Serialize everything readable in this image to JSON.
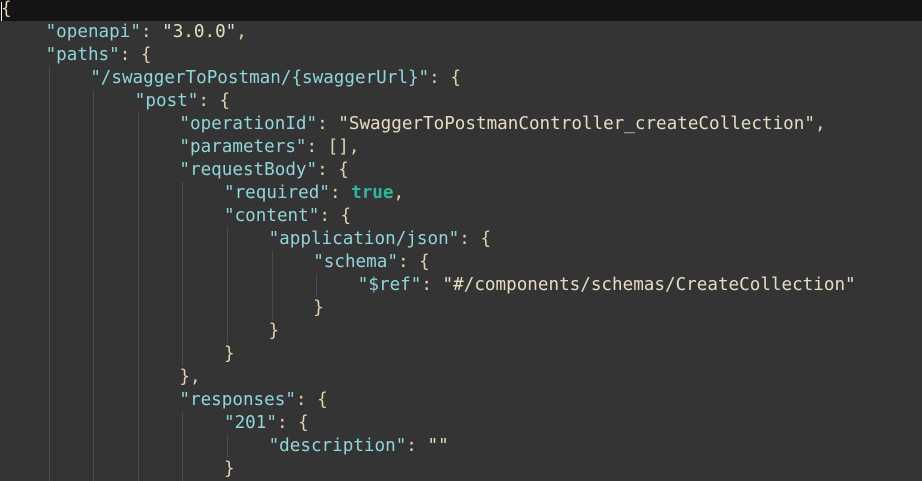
{
  "editor": {
    "lines": [
      {
        "indent": 0,
        "tokens": [
          {
            "t": "punct",
            "v": "{"
          }
        ]
      },
      {
        "indent": 1,
        "tokens": [
          {
            "t": "key",
            "v": "\"openapi\""
          },
          {
            "t": "punct",
            "v": ": "
          },
          {
            "t": "str",
            "v": "\"3.0.0\""
          },
          {
            "t": "punct",
            "v": ","
          }
        ]
      },
      {
        "indent": 1,
        "tokens": [
          {
            "t": "key",
            "v": "\"paths\""
          },
          {
            "t": "punct",
            "v": ": {"
          }
        ]
      },
      {
        "indent": 2,
        "tokens": [
          {
            "t": "key",
            "v": "\"/swaggerToPostman/{swaggerUrl}\""
          },
          {
            "t": "punct",
            "v": ": {"
          }
        ]
      },
      {
        "indent": 3,
        "tokens": [
          {
            "t": "key",
            "v": "\"post\""
          },
          {
            "t": "punct",
            "v": ": {"
          }
        ]
      },
      {
        "indent": 4,
        "tokens": [
          {
            "t": "key",
            "v": "\"operationId\""
          },
          {
            "t": "punct",
            "v": ": "
          },
          {
            "t": "str",
            "v": "\"SwaggerToPostmanController_createCollection\""
          },
          {
            "t": "punct",
            "v": ","
          }
        ]
      },
      {
        "indent": 4,
        "tokens": [
          {
            "t": "key",
            "v": "\"parameters\""
          },
          {
            "t": "punct",
            "v": ": [],"
          }
        ]
      },
      {
        "indent": 4,
        "tokens": [
          {
            "t": "key",
            "v": "\"requestBody\""
          },
          {
            "t": "punct",
            "v": ": {"
          }
        ]
      },
      {
        "indent": 5,
        "tokens": [
          {
            "t": "key",
            "v": "\"required\""
          },
          {
            "t": "punct",
            "v": ": "
          },
          {
            "t": "bool",
            "v": "true"
          },
          {
            "t": "punct",
            "v": ","
          }
        ]
      },
      {
        "indent": 5,
        "tokens": [
          {
            "t": "key",
            "v": "\"content\""
          },
          {
            "t": "punct",
            "v": ": {"
          }
        ]
      },
      {
        "indent": 6,
        "tokens": [
          {
            "t": "key",
            "v": "\"application/json\""
          },
          {
            "t": "punct",
            "v": ": {"
          }
        ]
      },
      {
        "indent": 7,
        "tokens": [
          {
            "t": "key",
            "v": "\"schema\""
          },
          {
            "t": "punct",
            "v": ": {"
          }
        ]
      },
      {
        "indent": 8,
        "tokens": [
          {
            "t": "key",
            "v": "\"$ref\""
          },
          {
            "t": "punct",
            "v": ": "
          },
          {
            "t": "str",
            "v": "\"#/components/schemas/CreateCollection\""
          }
        ]
      },
      {
        "indent": 7,
        "tokens": [
          {
            "t": "punct",
            "v": "}"
          }
        ]
      },
      {
        "indent": 6,
        "tokens": [
          {
            "t": "punct",
            "v": "}"
          }
        ]
      },
      {
        "indent": 5,
        "tokens": [
          {
            "t": "punct",
            "v": "}"
          }
        ]
      },
      {
        "indent": 4,
        "tokens": [
          {
            "t": "punct",
            "v": "},"
          }
        ]
      },
      {
        "indent": 4,
        "tokens": [
          {
            "t": "key",
            "v": "\"responses\""
          },
          {
            "t": "punct",
            "v": ": {"
          }
        ]
      },
      {
        "indent": 5,
        "tokens": [
          {
            "t": "key",
            "v": "\"201\""
          },
          {
            "t": "punct",
            "v": ": {"
          }
        ]
      },
      {
        "indent": 6,
        "tokens": [
          {
            "t": "key",
            "v": "\"description\""
          },
          {
            "t": "punct",
            "v": ": "
          },
          {
            "t": "str",
            "v": "\"\""
          }
        ]
      },
      {
        "indent": 5,
        "tokens": [
          {
            "t": "punct",
            "v": "}"
          }
        ]
      }
    ]
  }
}
